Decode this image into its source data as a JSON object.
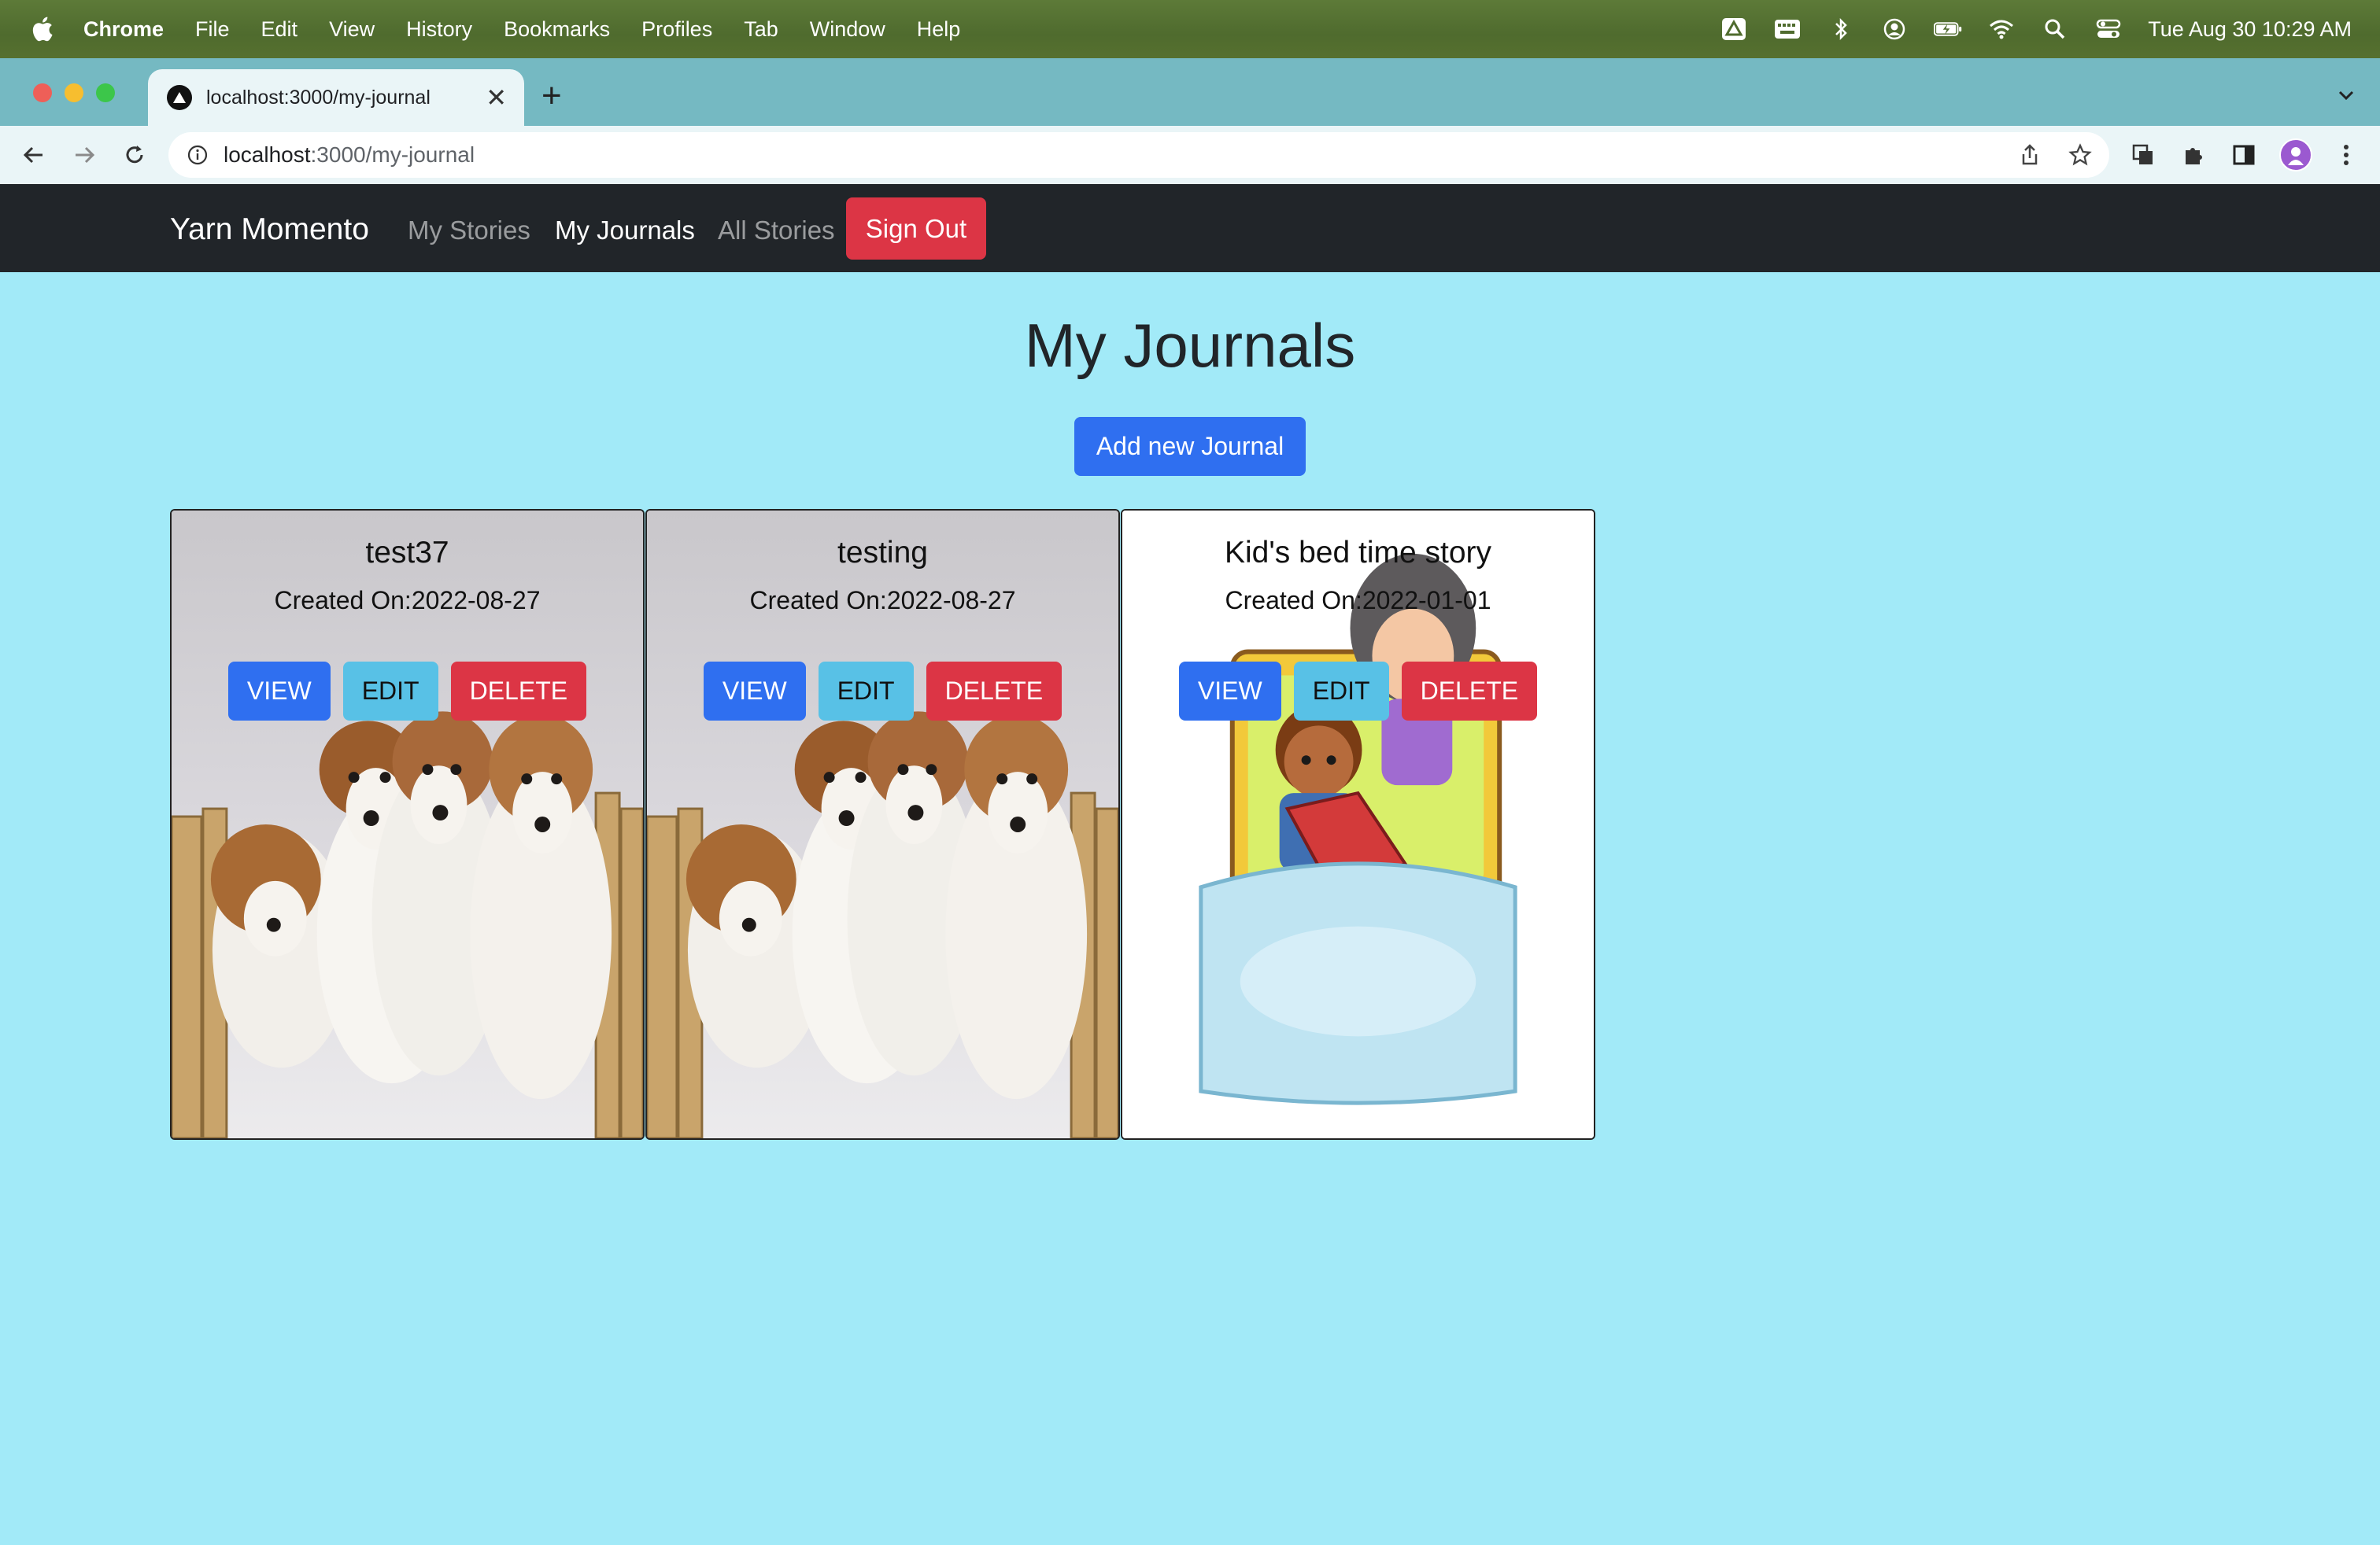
{
  "menubar": {
    "app_name": "Chrome",
    "items": [
      "File",
      "Edit",
      "View",
      "History",
      "Bookmarks",
      "Profiles",
      "Tab",
      "Window",
      "Help"
    ],
    "clock": "Tue Aug 30  10:29 AM",
    "status_icons": [
      "drive-icon",
      "keyboard-icon",
      "bluetooth-icon",
      "user-icon",
      "battery-icon",
      "wifi-icon",
      "spotlight-icon",
      "control-center-icon"
    ]
  },
  "browser": {
    "tab_title": "localhost:3000/my-journal",
    "url_host": "localhost",
    "url_path": ":3000/my-journal"
  },
  "navbar": {
    "brand": "Yarn Momento",
    "links": [
      "My Stories",
      "My Journals",
      "All Stories"
    ],
    "active_link": "My Journals",
    "signout": "Sign Out"
  },
  "page": {
    "title": "My Journals",
    "add_button": "Add new Journal"
  },
  "journals": [
    {
      "title": "test37",
      "created": "Created On:2022-08-27",
      "image": "puppies"
    },
    {
      "title": "testing",
      "created": "Created On:2022-08-27",
      "image": "puppies"
    },
    {
      "title": "Kid's bed time story",
      "created": "Created On:2022-01-01",
      "image": "bedtime-story-illustration"
    }
  ],
  "card_buttons": {
    "view": "VIEW",
    "edit": "EDIT",
    "delete": "DELETE"
  },
  "colors": {
    "page_bg": "#a2eaf8",
    "navbar_bg": "#212529",
    "primary": "#2f6ff0",
    "info": "#58c1e6",
    "danger": "#dc3545"
  }
}
